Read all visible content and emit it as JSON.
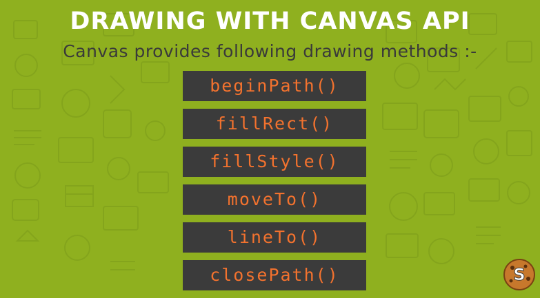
{
  "slide": {
    "title": "DRAWING WITH CANVAS API",
    "subtitle": "Canvas provides following drawing methods :-",
    "methods": [
      "beginPath()",
      "fillRect()",
      "fillStyle()",
      "moveTo()",
      "lineTo()",
      "closePath()"
    ],
    "logo_letter": "S"
  },
  "colors": {
    "background": "#8fb01f",
    "title": "#ffffff",
    "subtitle": "#3a3a3a",
    "method_box": "#3b3b3b",
    "method_text": "#f3722e",
    "logo_fill": "#c7782c"
  },
  "icons": [
    "cookie-logo-icon"
  ]
}
